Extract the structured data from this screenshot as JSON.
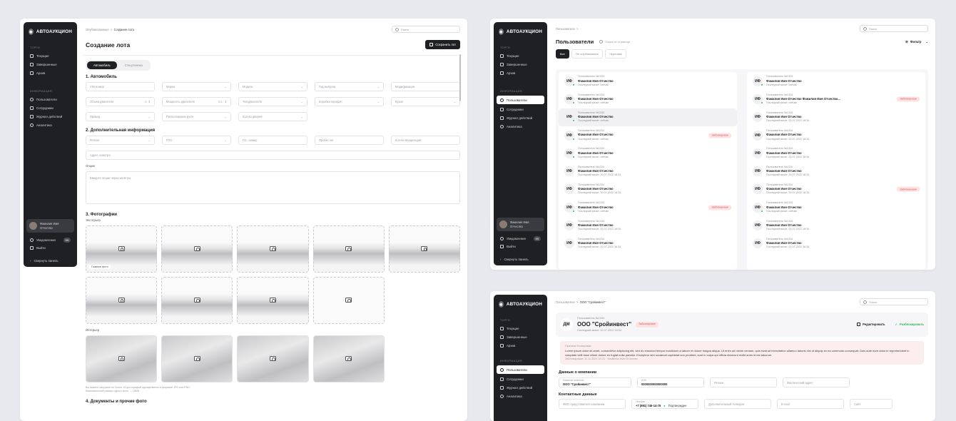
{
  "brand": "АВТОАУКЦИОН",
  "brand_mark": "◉",
  "nav": {
    "sec_trades": "ТОРГИ",
    "sec_info": "ИНФОРМАЦИЯ",
    "current": "Текущие",
    "finished": "Завершенные",
    "archive": "Архив",
    "users": "Пользователи",
    "staff": "Сотрудники",
    "log": "Журнал действий",
    "analytics": "Аналитика"
  },
  "user_name": "Фамилия Имя Отчество",
  "notifications": {
    "label": "Уведомления",
    "count": "99"
  },
  "logout": "Выйти",
  "collapse": "Свернуть панель",
  "search_placeholder": "Поиск",
  "lot": {
    "crumb_prev": "Опубликованные",
    "crumb_sep": ">",
    "crumb_cur": "Создание лота",
    "title": "Создание лота",
    "save": "Сохранить лот",
    "seg_auto": "Автомобиль",
    "seg_special": "Спецтехника",
    "sec1": "1. Автомобиль",
    "row1": [
      "VIN номер",
      "Марка",
      "Модель",
      "Год выпуска",
      "Модификация"
    ],
    "row2": [
      "Объем двигателя",
      "Мощность двигателя",
      "Тип двигателя",
      "Коробка передач",
      "Кузов"
    ],
    "unit_vol": "л",
    "unit_pow": "л.с.",
    "row3": [
      "Привод",
      "Расположение руля",
      "Кол-во дверей"
    ],
    "sec2": "2. Дополнительная информация",
    "row4": [
      "Регион",
      "ПТС",
      "Гос. номер",
      "Пробег, км",
      "Кол-во владельцев"
    ],
    "address": "Адрес осмотра",
    "options_label": "Опции",
    "options_placeholder": "Введите опции через запятую",
    "sec3": "3. Фотографии",
    "exterior": "Экстерьер",
    "main_photo": "Главное фото",
    "interior": "Интерьер",
    "hint1": "Вы можете загрузить не более 15 фотографий одновременно в формате JPG или PNG.",
    "hint2": "Максимальный размер одного фото — 15МБ.",
    "sec4": "4. Документы и прочие фото"
  },
  "users": {
    "crumb": "Пользователи",
    "crumb_sep": ">",
    "title": "Пользователи",
    "page_search": "Поиск по странице",
    "filter": "Фильтр",
    "tabs": [
      "Все",
      "Не опубликовано",
      "Черновик"
    ],
    "card_id": "Пользователь №1334",
    "card_name": "Фамилия Имя Отчество",
    "card_name_long": "Фамилия Имя Отчество Фамилия Имя Отчество...",
    "seen_now": "Последний визит: сейчас",
    "seen_date": "Последний визит: 20.07.2022 18:34",
    "blocked": "Заблокирован",
    "initials": "ИФ",
    "left": [
      {
        "online": true,
        "seen": "now",
        "blocked": false,
        "hl": false
      },
      {
        "online": true,
        "seen": "now",
        "blocked": false,
        "hl": false
      },
      {
        "online": true,
        "seen": "now",
        "blocked": false,
        "hl": true
      },
      {
        "online": true,
        "seen": "now",
        "blocked": true,
        "hl": false
      },
      {
        "online": true,
        "seen": "now",
        "blocked": false,
        "hl": false
      },
      {
        "online": false,
        "seen": "date",
        "blocked": false,
        "hl": false
      },
      {
        "online": false,
        "seen": "date",
        "blocked": false,
        "hl": false
      },
      {
        "online": true,
        "seen": "now",
        "blocked": true,
        "hl": false
      },
      {
        "online": false,
        "seen": "date",
        "blocked": false,
        "hl": false
      },
      {
        "online": false,
        "seen": "date",
        "blocked": false,
        "hl": false
      }
    ],
    "right": [
      {
        "online": true,
        "seen": "now",
        "blocked": false,
        "long": false
      },
      {
        "online": true,
        "seen": "now",
        "blocked": true,
        "long": true
      },
      {
        "online": false,
        "seen": "date",
        "blocked": false,
        "long": false
      },
      {
        "online": false,
        "seen": "date",
        "blocked": false,
        "long": false
      },
      {
        "online": false,
        "seen": "date",
        "blocked": false,
        "long": false
      },
      {
        "online": false,
        "seen": "date",
        "blocked": false,
        "long": false
      },
      {
        "online": false,
        "seen": "date",
        "blocked": true,
        "long": false
      },
      {
        "online": true,
        "seen": "now",
        "blocked": false,
        "long": false
      },
      {
        "online": false,
        "seen": "date",
        "blocked": false,
        "long": false
      },
      {
        "online": false,
        "seen": "date",
        "blocked": false,
        "long": false
      }
    ]
  },
  "company": {
    "crumb_prev": "Пользователи",
    "crumb_sep": ">",
    "crumb_cur": "ООО \"Сройинвест\"",
    "initials": "ДМ",
    "user_id": "Пользователь №1334",
    "name": "ООО \"Сройинвест\"",
    "blocked": "Заблокирован",
    "seen": "Последний визит: 20.07.2022 18:34",
    "edit": "Редактировать",
    "unblock": "Разблокировать",
    "reason_title": "Причина блокировки",
    "reason_text": "Lorem ipsum dolor sit amet, consectetur adipiscing elit, sed do eiusmod tempor incididunt ut labore et dolore magna aliqua. Ut enim ad minim veniam, quis nostrud exercitation ullamco laboris nisi ut aliquip ex ea commodo consequat. Duis aute irure dolor in reprehenderit in voluptate velit esse cillum dolore eu fugiat nulla pariatur. Excepteur sint occaecat cupidatat non proident, sunt in culpa qui officia deserunt mollit anim id est laborum.",
    "reason_meta": "Заблокирован: 11.11.2021 10:31 · Фамилия Имя Отчество",
    "data_title": "Данные о компании",
    "company_label": "Название компании",
    "company_val": "ООО \"Сройинвест\"",
    "inn_label": "ИНН",
    "inn_val": "0000000000000000",
    "region": "Регион",
    "addr": "Фактический адрес",
    "contacts_title": "Контактные данные",
    "rep": "ФИО представителя компании",
    "phone_label": "Телефон",
    "phone_val": "+7 (981) 746-14-75",
    "confirmed": "Подтвержден",
    "phone2": "Дополнительный телефон",
    "email": "E-mail",
    "site": "Сайт"
  },
  "colors": {
    "dark": "#1f2023",
    "accent_green": "#2fb557",
    "blocked_red": "#e0565e"
  }
}
